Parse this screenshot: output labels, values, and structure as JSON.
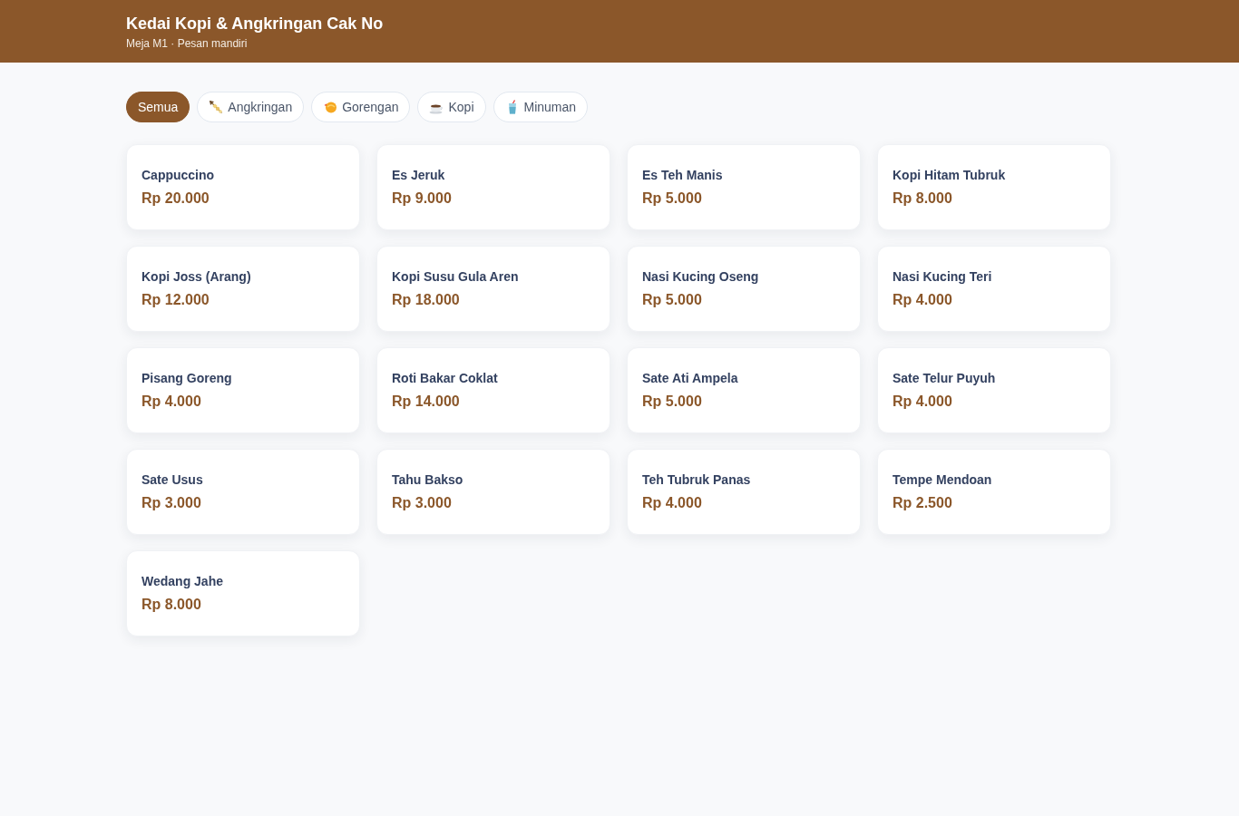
{
  "header": {
    "title": "Kedai Kopi & Angkringan Cak No",
    "subtitle": "Meja M1 · Pesan mandiri"
  },
  "tabs": [
    {
      "label": "Semua",
      "selected": true
    },
    {
      "label": "Angkringan",
      "selected": false
    },
    {
      "label": "Gorengan",
      "selected": false
    },
    {
      "label": "Kopi",
      "selected": false
    },
    {
      "label": "Minuman",
      "selected": false
    }
  ],
  "menu_items": [
    {
      "name": "Cappuccino",
      "price": "Rp 20.000"
    },
    {
      "name": "Es Jeruk",
      "price": "Rp 9.000"
    },
    {
      "name": "Es Teh Manis",
      "price": "Rp 5.000"
    },
    {
      "name": "Kopi Hitam Tubruk",
      "price": "Rp 8.000"
    },
    {
      "name": "Kopi Joss (Arang)",
      "price": "Rp 12.000"
    },
    {
      "name": "Kopi Susu Gula Aren",
      "price": "Rp 18.000"
    },
    {
      "name": "Nasi Kucing Oseng",
      "price": "Rp 5.000"
    },
    {
      "name": "Nasi Kucing Teri",
      "price": "Rp 4.000"
    },
    {
      "name": "Pisang Goreng",
      "price": "Rp 4.000"
    },
    {
      "name": "Roti Bakar Coklat",
      "price": "Rp 14.000"
    },
    {
      "name": "Sate Ati Ampela",
      "price": "Rp 5.000"
    },
    {
      "name": "Sate Telur Puyuh",
      "price": "Rp 4.000"
    },
    {
      "name": "Sate Usus",
      "price": "Rp 3.000"
    },
    {
      "name": "Tahu Bakso",
      "price": "Rp 3.000"
    },
    {
      "name": "Teh Tubruk Panas",
      "price": "Rp 4.000"
    },
    {
      "name": "Tempe Mendoan",
      "price": "Rp 2.500"
    },
    {
      "name": "Wedang Jahe",
      "price": "Rp 8.000"
    }
  ]
}
